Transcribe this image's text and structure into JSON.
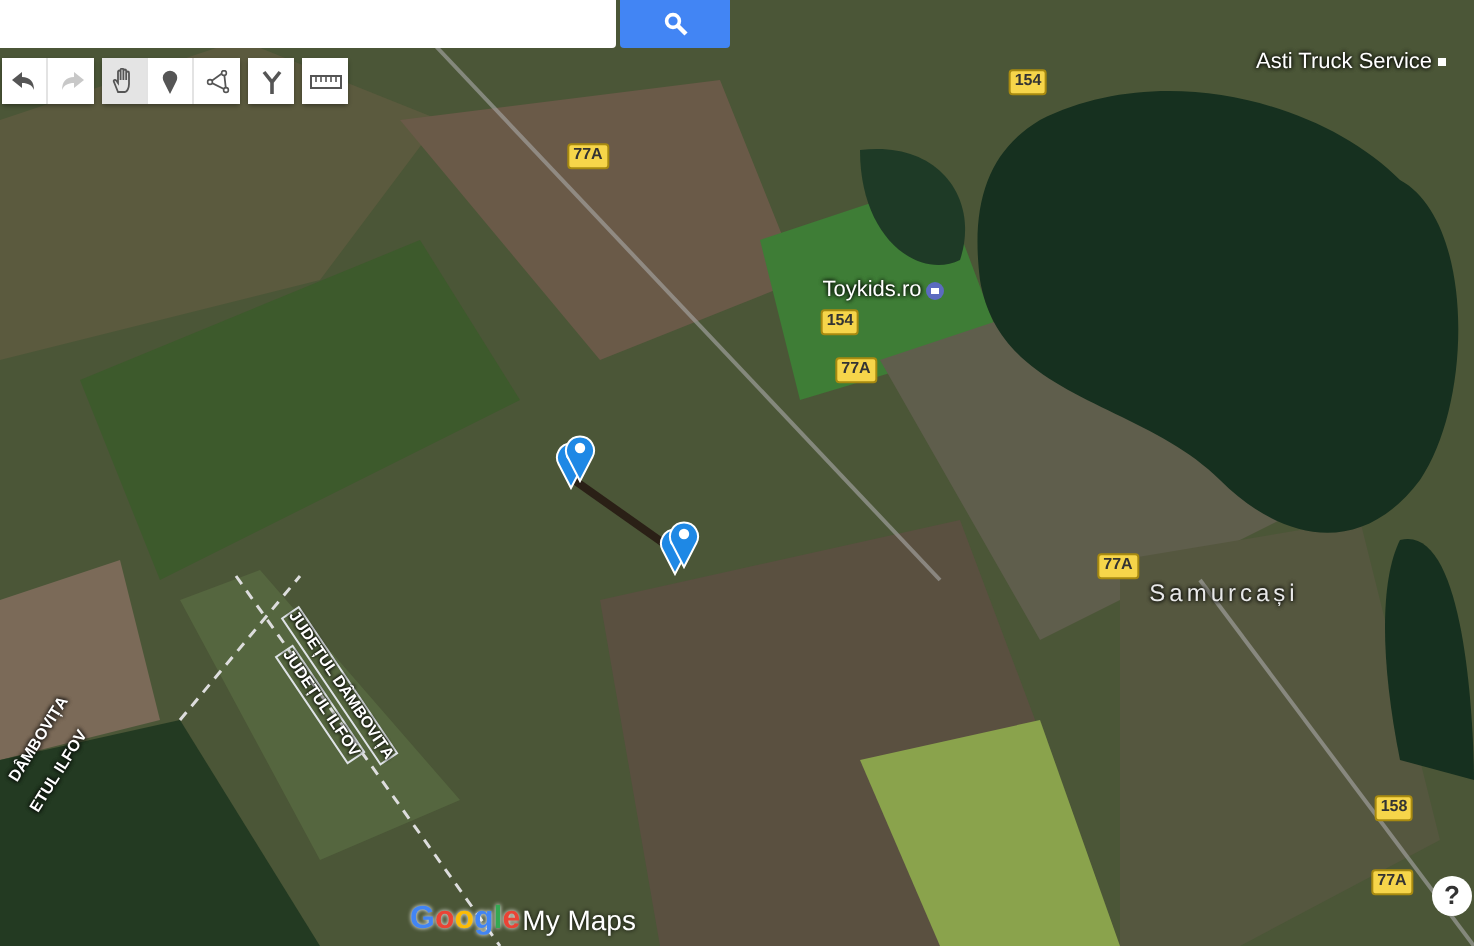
{
  "toolbar_groups": [
    {
      "tools": [
        {
          "kind": "undo",
          "selected": false,
          "disabled": false
        },
        {
          "kind": "redo",
          "selected": false,
          "disabled": true
        }
      ]
    },
    {
      "tools": [
        {
          "kind": "hand",
          "selected": true,
          "disabled": false
        },
        {
          "kind": "marker",
          "selected": false,
          "disabled": false
        },
        {
          "kind": "line",
          "selected": false,
          "disabled": false
        }
      ]
    },
    {
      "tools": [
        {
          "kind": "route",
          "selected": false,
          "disabled": false
        }
      ]
    },
    {
      "tools": [
        {
          "kind": "ruler",
          "selected": false,
          "disabled": false
        }
      ]
    }
  ],
  "map_labels": [
    {
      "kind": "place",
      "text": "Asti Truck Service"
    },
    {
      "kind": "shop",
      "text": "Toykids.ro"
    },
    {
      "kind": "town",
      "text": "Samurcași"
    },
    {
      "kind": "road",
      "text": "154"
    },
    {
      "kind": "road",
      "text": "77A"
    },
    {
      "kind": "road",
      "text": "154"
    },
    {
      "kind": "road",
      "text": "77A"
    },
    {
      "kind": "road",
      "text": "77A"
    },
    {
      "kind": "road",
      "text": "158"
    },
    {
      "kind": "road",
      "text": "77A"
    },
    {
      "kind": "border",
      "text": "JUDEȚUL DÂMBOVIȚA"
    },
    {
      "kind": "border",
      "text": "JUDEȚUL ILFOV"
    },
    {
      "kind": "border_left",
      "text": "DÂMBOVIȚA"
    },
    {
      "kind": "border_left",
      "text": "ETUL ILFOV"
    }
  ],
  "logo": {
    "brand": "Google",
    "product": "My Maps"
  },
  "help_button": "?"
}
